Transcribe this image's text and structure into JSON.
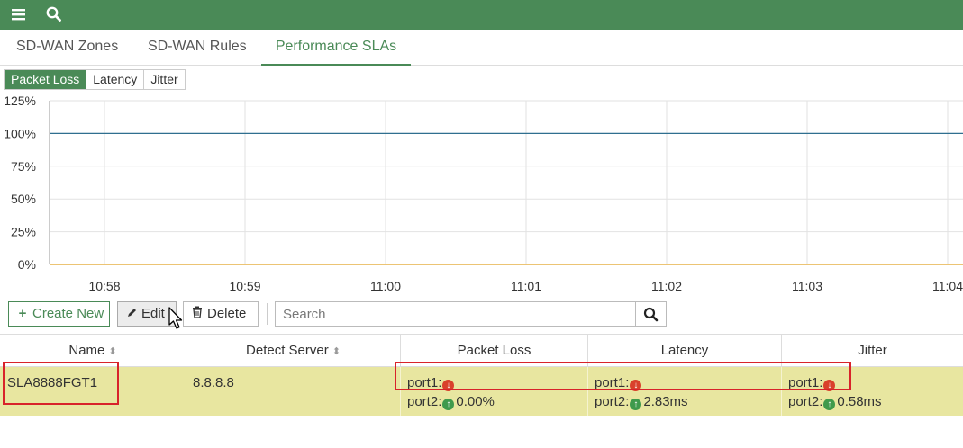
{
  "topbar": {
    "menu_icon": "hamburger-menu-icon",
    "search_icon": "search-icon",
    "color": "#4a8a57"
  },
  "tabs": [
    {
      "label": "SD-WAN Zones"
    },
    {
      "label": "SD-WAN Rules"
    },
    {
      "label": "Performance SLAs",
      "active": true
    }
  ],
  "subtabs": [
    {
      "label": "Packet Loss",
      "active": true
    },
    {
      "label": "Latency"
    },
    {
      "label": "Jitter"
    }
  ],
  "chart_data": {
    "type": "line",
    "x": [
      "10:58",
      "10:59",
      "11:00",
      "11:01",
      "11:02",
      "11:03",
      "11:04"
    ],
    "yticks": [
      "125%",
      "100%",
      "75%",
      "50%",
      "25%",
      "0%"
    ],
    "ylim": [
      0,
      125
    ],
    "series": [
      {
        "color": "#2f6f8f",
        "values": [
          100,
          100,
          100,
          100,
          100,
          100,
          100
        ]
      },
      {
        "color": "#e0a020",
        "values": [
          0,
          0,
          0,
          0,
          0,
          0,
          0
        ]
      }
    ],
    "grid": true
  },
  "toolbar": {
    "create_label": "Create New",
    "edit_label": "Edit",
    "delete_label": "Delete",
    "search_placeholder": "Search"
  },
  "table": {
    "columns": [
      "Name",
      "Detect Server",
      "Packet Loss",
      "Latency",
      "Jitter"
    ],
    "rows": [
      {
        "name": "SLA8888FGT1",
        "server": "8.8.8.8",
        "packet_loss": {
          "p1": "port1:",
          "p2": "port2:",
          "p2_val": "0.00%"
        },
        "latency": {
          "p1": "port1:",
          "p2": "port2:",
          "p2_val": "2.83ms"
        },
        "jitter": {
          "p1": "port1:",
          "p2": "port2:",
          "p2_val": "0.58ms"
        }
      }
    ]
  }
}
